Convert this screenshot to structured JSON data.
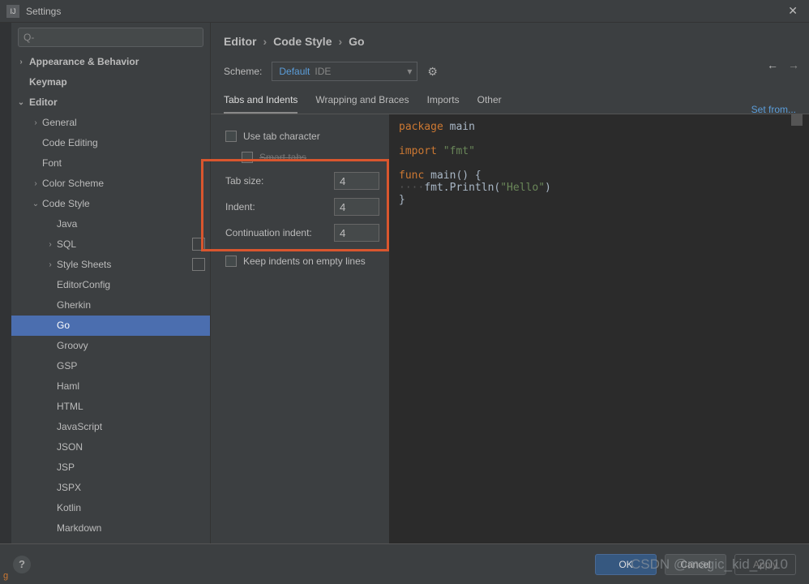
{
  "window": {
    "title": "Settings"
  },
  "search": {
    "placeholder": "Q-"
  },
  "tree": {
    "items": [
      {
        "label": "Appearance & Behavior",
        "level": 0,
        "bold": true,
        "exp": "›"
      },
      {
        "label": "Keymap",
        "level": 0,
        "bold": true
      },
      {
        "label": "Editor",
        "level": 0,
        "bold": true,
        "exp": "⌄"
      },
      {
        "label": "General",
        "level": 1,
        "exp": "›"
      },
      {
        "label": "Code Editing",
        "level": 1
      },
      {
        "label": "Font",
        "level": 1
      },
      {
        "label": "Color Scheme",
        "level": 1,
        "exp": "›"
      },
      {
        "label": "Code Style",
        "level": 1,
        "exp": "⌄"
      },
      {
        "label": "Java",
        "level": 2
      },
      {
        "label": "SQL",
        "level": 2,
        "exp": "›",
        "badge": true
      },
      {
        "label": "Style Sheets",
        "level": 2,
        "exp": "›",
        "badge": true
      },
      {
        "label": "EditorConfig",
        "level": 2
      },
      {
        "label": "Gherkin",
        "level": 2
      },
      {
        "label": "Go",
        "level": 2,
        "selected": true
      },
      {
        "label": "Groovy",
        "level": 2
      },
      {
        "label": "GSP",
        "level": 2
      },
      {
        "label": "Haml",
        "level": 2
      },
      {
        "label": "HTML",
        "level": 2
      },
      {
        "label": "JavaScript",
        "level": 2
      },
      {
        "label": "JSON",
        "level": 2
      },
      {
        "label": "JSP",
        "level": 2
      },
      {
        "label": "JSPX",
        "level": 2
      },
      {
        "label": "Kotlin",
        "level": 2
      },
      {
        "label": "Markdown",
        "level": 2
      }
    ]
  },
  "breadcrumb": {
    "a": "Editor",
    "b": "Code Style",
    "c": "Go"
  },
  "scheme": {
    "label": "Scheme:",
    "value": "Default",
    "scope": "IDE"
  },
  "set_from": "Set from...",
  "tabs": {
    "items": [
      {
        "label": "Tabs and Indents",
        "active": true
      },
      {
        "label": "Wrapping and Braces"
      },
      {
        "label": "Imports"
      },
      {
        "label": "Other"
      }
    ]
  },
  "form": {
    "use_tab_char": "Use tab character",
    "smart_tabs": "Smart tabs",
    "tab_size_label": "Tab size:",
    "tab_size_value": "4",
    "indent_label": "Indent:",
    "indent_value": "4",
    "cont_label": "Continuation indent:",
    "cont_value": "4",
    "keep_empty": "Keep indents on empty lines"
  },
  "preview": {
    "l1a": "package",
    "l1b": " main",
    "l2a": "import",
    "l2b": " \"fmt\"",
    "l3a": "func",
    "l3b": " main() {",
    "l4dots": "····",
    "l4a": "fmt.Println(",
    "l4b": "\"Hello\"",
    "l4c": ")",
    "l5": "}"
  },
  "buttons": {
    "ok": "OK",
    "cancel": "Cancel",
    "apply": "Apply"
  },
  "watermark": "CSDN @magic_kid_2010"
}
